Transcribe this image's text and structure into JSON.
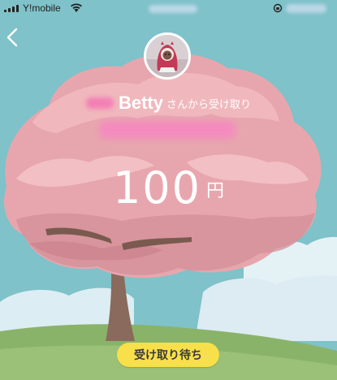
{
  "status_bar": {
    "carrier": "Y!mobile",
    "wifi_icon": "wifi-icon",
    "lock_icon": "orientation-lock-icon"
  },
  "nav": {
    "back_icon": "chevron-left-icon"
  },
  "receipt": {
    "sender_name": "Betty",
    "sender_suffix": "さんから受け取り",
    "amount": "100",
    "currency": "円",
    "status_label": "受け取り待ち"
  },
  "colors": {
    "sky": "#7fc2c9",
    "blossom": "#eeaab0",
    "trunk": "#8a6a5c",
    "cloud": "#dceef3",
    "grass": "#8ab36a",
    "button": "#f7e04a",
    "blur_pink": "#f37fb4"
  }
}
